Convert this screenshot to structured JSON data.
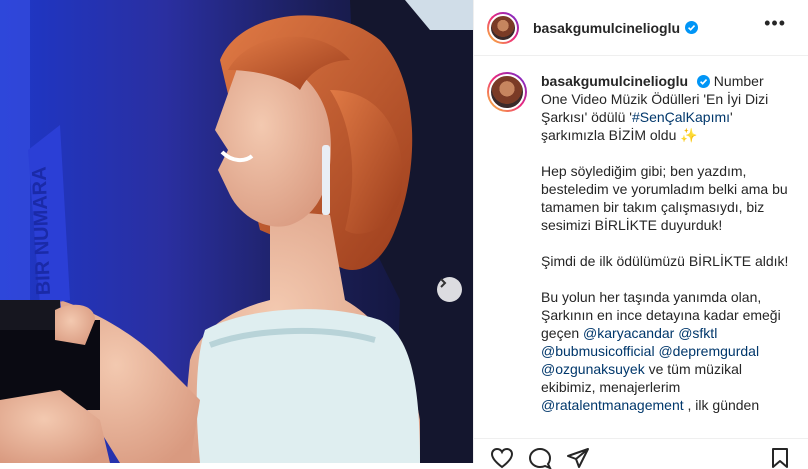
{
  "post": {
    "username": "basakgumulcinelioglu",
    "verified": true,
    "more_label": "•••"
  },
  "caption": {
    "username": "basakgumulcinelioglu",
    "intro_1": " Number One Video Müzik Ödülleri 'En İyi Dizi Şarkısı' ödülü '",
    "hashtag": "#SenÇalKapımı",
    "intro_2": "' şarkımızla BİZİM oldu ",
    "sparkle": "✨",
    "para1": "Hep söylediğim gibi; ben yazdım, besteledim ve yorumladım belki ama bu tamamen bir takım çalışmasıydı, biz sesimizi BİRLİKTE duyurduk!",
    "para2": "Şimdi de ilk ödülümüzü BİRLİKTE aldık!",
    "para3_1": "Bu yolun her taşında yanımda olan, Şarkının en ince detayına kadar emeği geçen ",
    "mention_1": "@karyacandar",
    "mention_2": "@sfktl",
    "mention_3": "@bubmusicofficial",
    "mention_4": "@depremgurdal",
    "mention_5": "@ozgunaksuyek",
    "para3_2": " ve tüm müzikal ekibimiz, menajerlerim ",
    "mention_6": "@ratalentmanagement",
    "para3_3": " , ilk günden"
  },
  "media": {
    "award_text": "BIR NUMARA",
    "next_icon": "chevron-right-icon"
  },
  "colors": {
    "text": "#262626",
    "link": "#00376b",
    "verified": "#0095f6"
  }
}
